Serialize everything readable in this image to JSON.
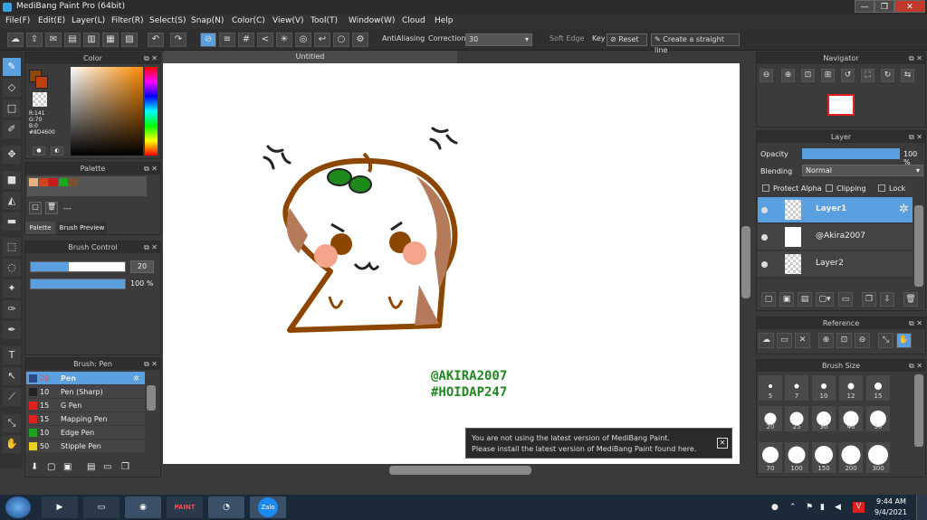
{
  "window": {
    "title": "MediBang Paint Pro (64bit)",
    "min": "—",
    "max": "❐",
    "close": "✕"
  },
  "menu": [
    "File(F)",
    "Edit(E)",
    "Layer(L)",
    "Filter(R)",
    "Select(S)",
    "Snap(N)",
    "Color(C)",
    "View(V)",
    "Tool(T)",
    "Window(W)",
    "Cloud",
    "Help"
  ],
  "toolbar": {
    "antialiasing": "AntiAliasing",
    "correction_label": "Correction",
    "correction_value": "30",
    "soft_edge": "Soft Edge",
    "key_label": "Key",
    "reset": "Reset",
    "straight_line": "Create a straight line"
  },
  "color_panel": {
    "title": "Color",
    "r": "R:141",
    "g": "G:70",
    "b": "B:0",
    "hex": "#8D4600"
  },
  "palette_panel": {
    "title": "Palette",
    "swatches": [
      "#e8b080",
      "#d4441c",
      "#c81c1c",
      "#1ca81c",
      "#7a5030"
    ],
    "entry": "---",
    "tab_palette": "Palette",
    "tab_preview": "Brush Preview"
  },
  "brush_control": {
    "title": "Brush Control",
    "size": "20",
    "opacity": "100 %"
  },
  "brush_panel": {
    "title": "Brush: Pen",
    "items": [
      {
        "size": "20",
        "name": "Pen",
        "color": "#2a4a8a"
      },
      {
        "size": "10",
        "name": "Pen (Sharp)",
        "color": "#222222"
      },
      {
        "size": "15",
        "name": "G Pen",
        "color": "#e02020"
      },
      {
        "size": "15",
        "name": "Mapping Pen",
        "color": "#e02020"
      },
      {
        "size": "10",
        "name": "Edge Pen",
        "color": "#20a020"
      },
      {
        "size": "50",
        "name": "Stipple Pen",
        "color": "#e8d020"
      }
    ]
  },
  "canvas": {
    "tab": "Untitled",
    "watermark_line1": "@AKIRA2007",
    "watermark_line2": "#HOIDAP247",
    "notice_line1": "You are not using the latest version of MediBang Paint.",
    "notice_line2": "Please install the latest version of MediBang Paint found here.",
    "notice_close": "✕"
  },
  "navigator": {
    "title": "Navigator"
  },
  "layer_panel": {
    "title": "Layer",
    "opacity_label": "Opacity",
    "opacity_value": "100 %",
    "blending_label": "Blending",
    "blending_value": "Normal",
    "protect_alpha": "Protect Alpha",
    "clipping": "Clipping",
    "lock": "Lock",
    "layers": [
      {
        "name": "Layer1"
      },
      {
        "name": "@Akira2007"
      },
      {
        "name": "Layer2"
      }
    ]
  },
  "reference": {
    "title": "Reference"
  },
  "brush_size": {
    "title": "Brush Size",
    "sizes": [
      "5",
      "7",
      "10",
      "12",
      "15",
      "20",
      "25",
      "30",
      "40",
      "50",
      "70",
      "100",
      "150",
      "200",
      "300"
    ]
  },
  "taskbar": {
    "time": "9:44 AM",
    "date": "9/4/2021",
    "zalo": "Zalo",
    "app_label": "PAINT"
  },
  "colors": {
    "accent": "#5aa0e0",
    "brown": "#8D4600",
    "green": "#1e8a1e"
  }
}
